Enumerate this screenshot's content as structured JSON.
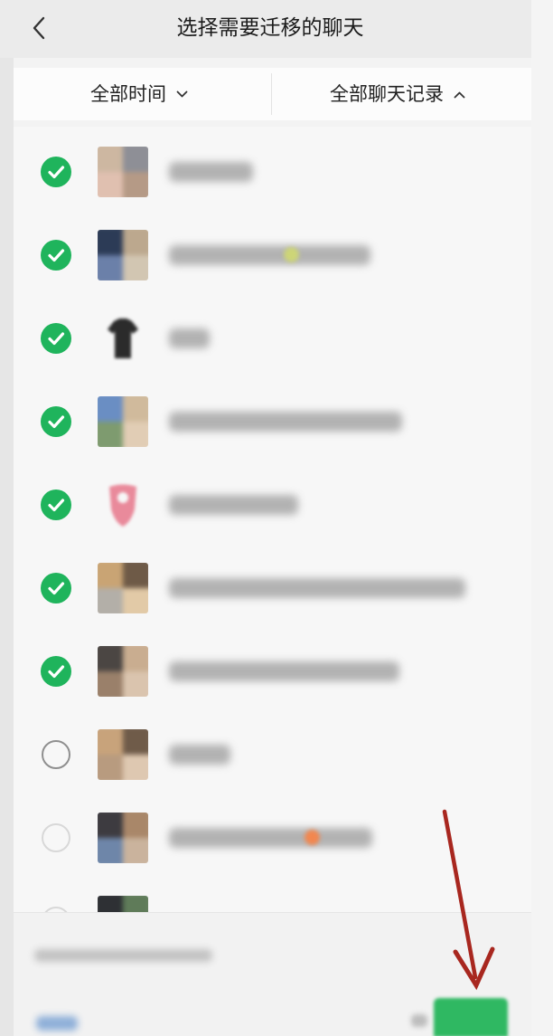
{
  "header": {
    "title": "选择需要迁移的聊天",
    "back_icon": "back-chevron-icon"
  },
  "filters": {
    "time": {
      "label": "全部时间",
      "icon": "chevron-down-icon"
    },
    "chats": {
      "label": "全部聊天记录",
      "icon": "chevron-up-icon"
    }
  },
  "chat_list": [
    {
      "checked": true,
      "avatar": "photo-avatar"
    },
    {
      "checked": true,
      "avatar": "photo-avatar"
    },
    {
      "checked": true,
      "avatar": "shirt-avatar"
    },
    {
      "checked": true,
      "avatar": "photo-avatar"
    },
    {
      "checked": true,
      "avatar": "pink-avatar"
    },
    {
      "checked": true,
      "avatar": "photo-avatar"
    },
    {
      "checked": true,
      "avatar": "photo-avatar"
    },
    {
      "checked": false,
      "avatar": "photo-avatar"
    },
    {
      "checked": false,
      "avatar": "photo-avatar"
    },
    {
      "checked": false,
      "avatar": "photo-avatar"
    }
  ],
  "colors": {
    "accent": "#1fb45c",
    "annotation_arrow": "#a8271f"
  }
}
